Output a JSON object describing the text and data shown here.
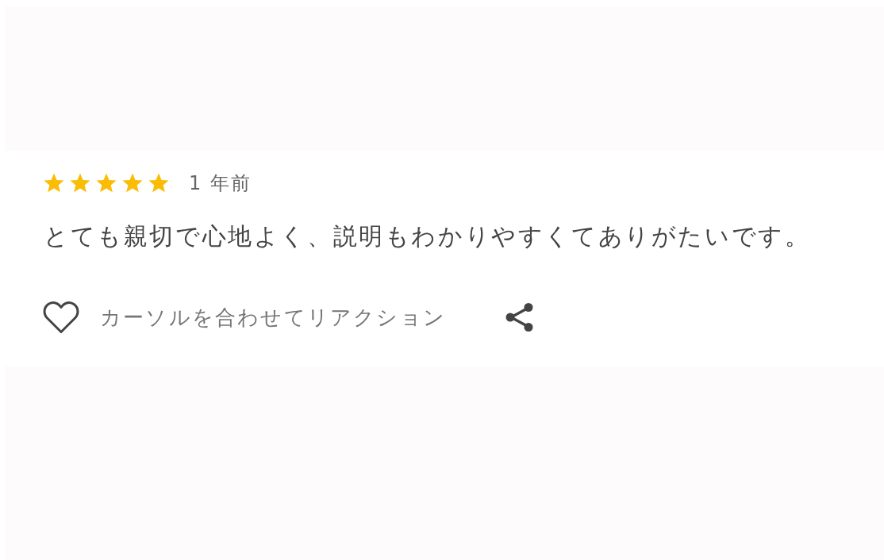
{
  "review": {
    "stars": 5,
    "date": "1 年前",
    "text": "とても親切で心地よく、説明もわかりやすくてありがたいです。",
    "reaction_hint": "カーソルを合わせてリアクション"
  }
}
